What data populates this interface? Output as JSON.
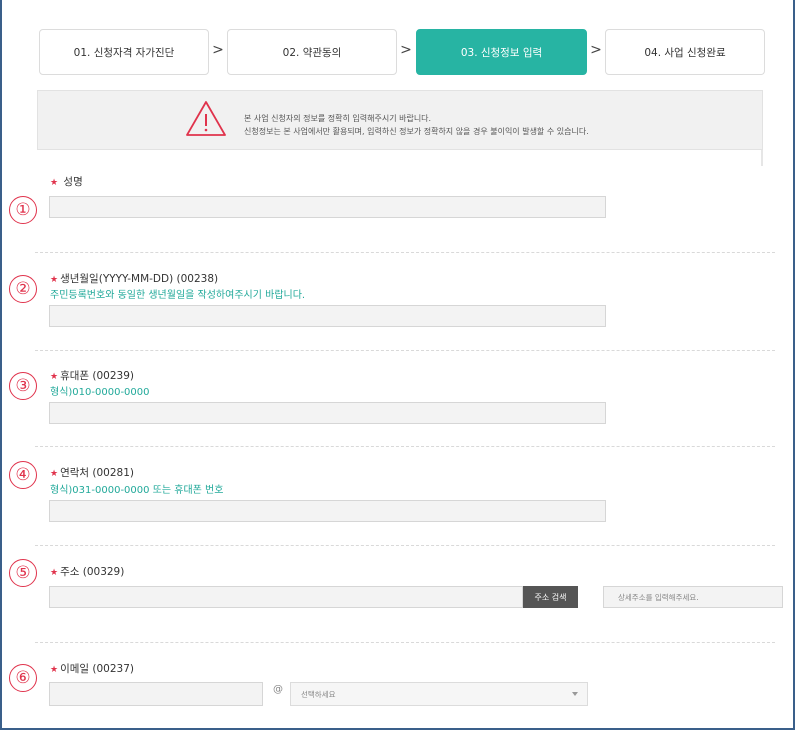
{
  "steps": [
    {
      "label": "01. 신청자격 자가진단",
      "active": false
    },
    {
      "label": "02. 약관동의",
      "active": false
    },
    {
      "label": "03. 신청정보 입력",
      "active": true
    },
    {
      "label": "04. 사업 신청완료",
      "active": false
    }
  ],
  "step_arrow": ">",
  "notice": {
    "line1": "본 사업 신청자의 정보를 정확히 입력해주시기 바랍니다.",
    "line2": "신청정보는 본 사업에서만 활용되며, 입력하신 정보가 정확하지 않을 경우 불이익이 발생할 수 있습니다."
  },
  "required_mark": "★",
  "markers": [
    "①",
    "②",
    "③",
    "④",
    "⑤",
    "⑥"
  ],
  "fields": {
    "name": {
      "label": "성명"
    },
    "birth": {
      "label": "생년월일(YYYY-MM-DD) (00238)",
      "hint": "주민등록번호와 동일한 생년월일을 작성하여주시기 바랍니다."
    },
    "mobile": {
      "label": "휴대폰 (00239)",
      "hint": "형식)010-0000-0000"
    },
    "contact": {
      "label": "연락처 (00281)",
      "hint": "형식)031-0000-0000 또는 휴대폰 번호"
    },
    "address": {
      "label": "주소 (00329)",
      "search_button": "주소 검색",
      "detail_placeholder": "상세주소를 입력해주세요."
    },
    "email": {
      "label": "이메일 (00237)",
      "at": "@",
      "domain_select": "선택하세요"
    }
  },
  "colors": {
    "accent": "#27b4a3",
    "required": "#e0334c",
    "hint": "#22a99a",
    "frame": "#3a5f8a"
  }
}
